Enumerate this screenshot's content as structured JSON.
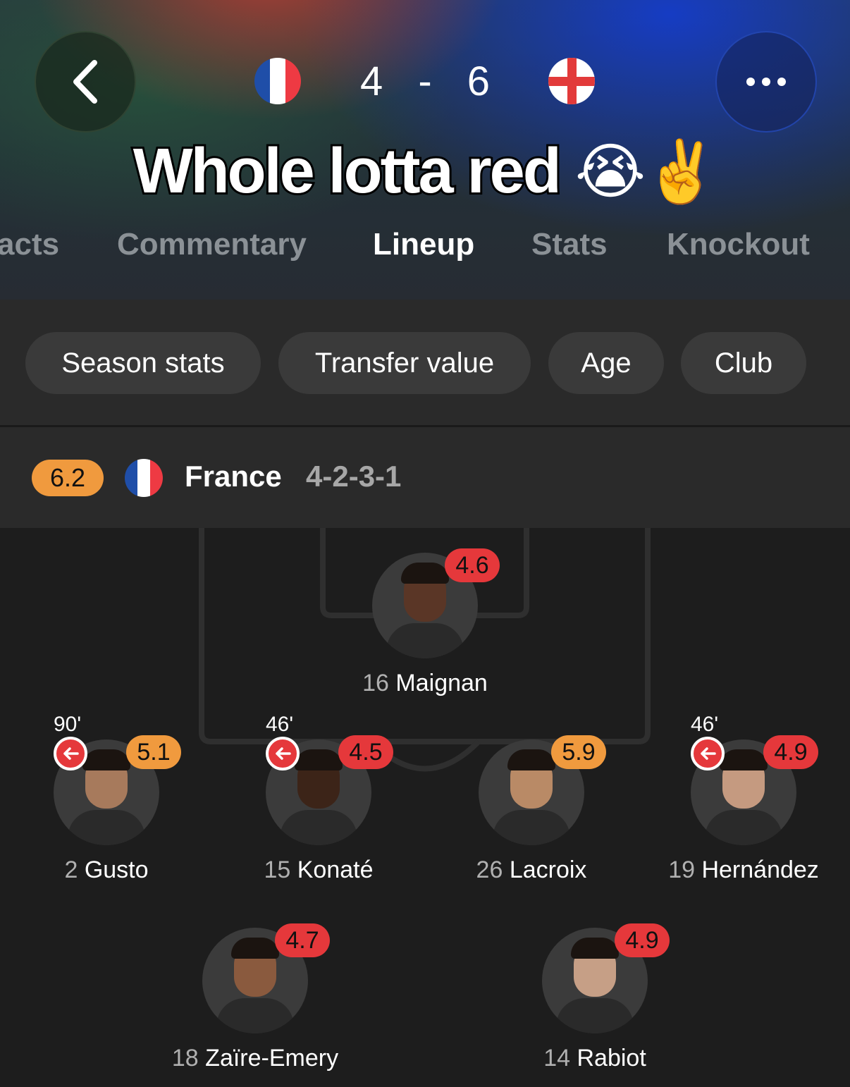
{
  "header": {
    "score_home": "4",
    "score_sep": "-",
    "score_away": "6",
    "caption": "Whole lotta red",
    "caption_emojis": "😭✌️",
    "tabs": [
      "acts",
      "Commentary",
      "Lineup",
      "Stats",
      "Knockout"
    ],
    "active_tab": "Lineup"
  },
  "filters": [
    "Season stats",
    "Transfer value",
    "Age",
    "Club"
  ],
  "team": {
    "rating": "6.2",
    "name": "France",
    "formation": "4-2-3-1"
  },
  "players": [
    {
      "number": "16",
      "name": "Maignan",
      "rating": "4.6",
      "rating_color": "red",
      "sub_minute": ""
    },
    {
      "number": "2",
      "name": "Gusto",
      "rating": "5.1",
      "rating_color": "orange",
      "sub_minute": "90'"
    },
    {
      "number": "15",
      "name": "Konaté",
      "rating": "4.5",
      "rating_color": "red",
      "sub_minute": "46'"
    },
    {
      "number": "26",
      "name": "Lacroix",
      "rating": "5.9",
      "rating_color": "orange",
      "sub_minute": ""
    },
    {
      "number": "19",
      "name": "Hernández",
      "rating": "4.9",
      "rating_color": "red",
      "sub_minute": "46'"
    },
    {
      "number": "18",
      "name": "Zaïre-Emery",
      "rating": "4.7",
      "rating_color": "red",
      "sub_minute": ""
    },
    {
      "number": "14",
      "name": "Rabiot",
      "rating": "4.9",
      "rating_color": "red",
      "sub_minute": ""
    }
  ],
  "colors": {
    "rating_red": "#e5383b",
    "rating_orange": "#f09a3e"
  }
}
